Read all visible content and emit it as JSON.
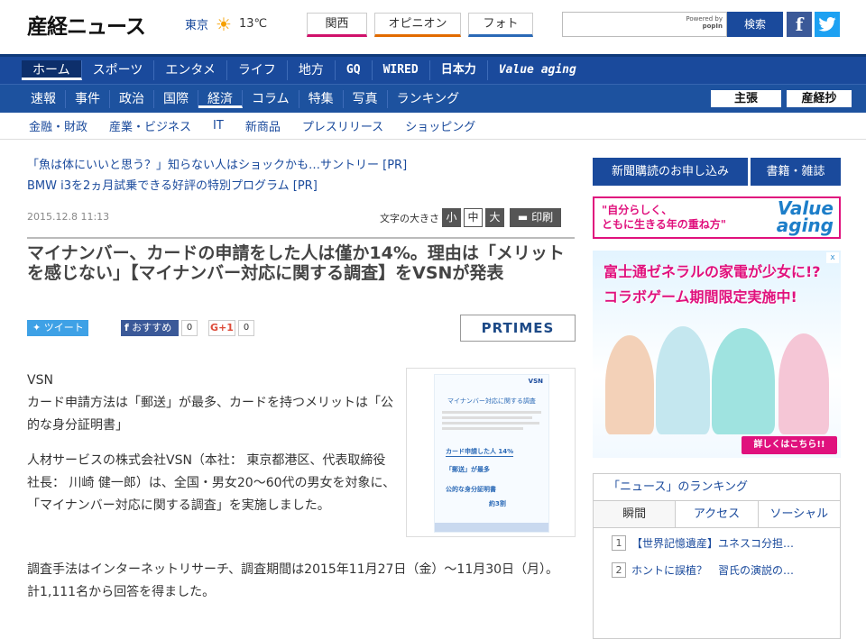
{
  "header": {
    "logo": "産経ニュース",
    "weather": {
      "city": "東京",
      "temp": "13℃",
      "icon": "sun-icon"
    },
    "top_tabs": [
      "関西",
      "オピニオン",
      "フォト"
    ],
    "search": {
      "placeholder": "",
      "powered_by": "Powered by",
      "provider": "popIn",
      "button": "検索"
    },
    "social": {
      "facebook": "f",
      "twitter": "t"
    }
  },
  "nav_main": [
    "ホーム",
    "スポーツ",
    "エンタメ",
    "ライフ",
    "地方",
    "GQ",
    "WIRED",
    "日本力",
    "Value aging"
  ],
  "nav_sub": [
    "速報",
    "事件",
    "政治",
    "国際",
    "経済",
    "コラム",
    "特集",
    "写真",
    "ランキング"
  ],
  "nav_papers": [
    "主張",
    "産経抄"
  ],
  "nav_category": [
    "金融・財政",
    "産業・ビジネス",
    "IT",
    "新商品",
    "プレスリリース",
    "ショッピング"
  ],
  "ads_text": [
    "「魚は体にいいと思う？」知らない人はショックかも…サントリー [PR]",
    "BMW i3を2ヵ月試乗できる好評の特別プログラム [PR]"
  ],
  "article": {
    "date": "2015.12.8 11:13",
    "font_size_label": "文字の大きさ",
    "font_sizes": [
      "小",
      "中",
      "大"
    ],
    "print_label": "印刷",
    "title": "マイナンバー、カードの申請をした人は僅か14%。理由は「メリットを感じない」【マイナンバー対応に関する調査】をVSNが発表",
    "share": {
      "tweet": "ツイート",
      "facebook": "おすすめ",
      "facebook_count": "0",
      "gplus": "G+1",
      "gplus_count": "0"
    },
    "source_logo": "PRTIMES",
    "body_lead": [
      "VSN",
      "カード申請方法は「郵送」が最多、カードを持つメリットは「公的な身分証明書」"
    ],
    "body_p1": "人材サービスの株式会社VSN（本社： 東京都港区、代表取締役社長： 川崎 健一郎）は、全国・男女20～60代の男女を対象に、「マイナンバー対応に関する調査」を実施しました。",
    "body_p2": "調査手法はインターネットリサーチ、調査期間は2015年11月27日（金）～11月30日（月）。",
    "body_p3": "計1,111名から回答を得ました。",
    "thumb": {
      "brand": "VSN",
      "title": "マイナンバー対応に関する調査",
      "b1": "カード申請した人 14%",
      "b2": "「郵送」が最多",
      "b3": "公的な身分証明書",
      "b4": "約3割"
    }
  },
  "sidebar": {
    "subscribe": "新聞購読のお申し込み",
    "books": "書籍・雑誌",
    "value_ad": {
      "line1": "\"自分らしく、",
      "line2": "ともに生きる年の重ね方\"",
      "brand1": "Value",
      "brand2": "aging"
    },
    "banner": {
      "line1": "富士通ゼネラルの家電が少女に!?",
      "line2": "コラボゲーム期間限定実施中!",
      "cta": "詳しくはこちら!!",
      "close": "x"
    },
    "ranking": {
      "title": "「ニュース」のランキング",
      "tabs": [
        "瞬間",
        "アクセス",
        "ソーシャル"
      ],
      "items": [
        {
          "no": "1",
          "text": "【世界記憶遺産】ユネスコ分担…"
        },
        {
          "no": "2",
          "text": "ホントに誤植？　習氏の演説の…"
        }
      ]
    }
  },
  "colors": {
    "brand_blue": "#1a4a9c",
    "nav_dark": "#0d2f6b",
    "accent_pink": "#e0117d",
    "twitter": "#1da1f2",
    "facebook": "#3b5998"
  }
}
